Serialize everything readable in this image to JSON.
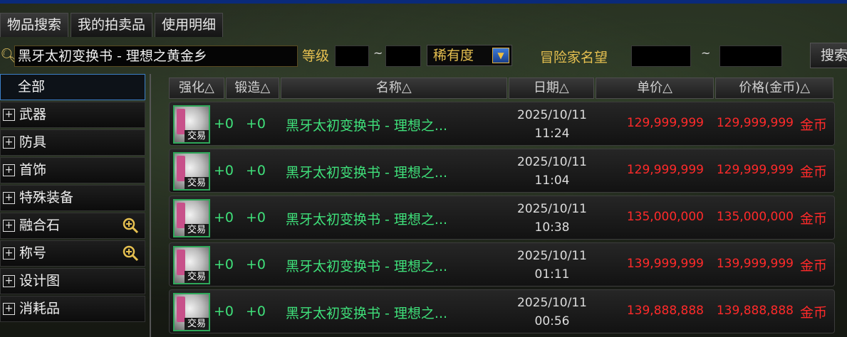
{
  "tabs": [
    "物品搜索",
    "我的拍卖品",
    "使用明细"
  ],
  "search": {
    "keyword": "黑牙太初变换书 - 理想之黄金乡",
    "level_label": "等级",
    "level_sep": "~",
    "rarity_label": "稀有度",
    "adventurer_label": "冒险家名望",
    "adventurer_sep": "~",
    "button_label": "搜索"
  },
  "sidebar": {
    "items": [
      {
        "label": "全部",
        "expandable": false,
        "zoom": false
      },
      {
        "label": "武器",
        "expandable": true,
        "zoom": false
      },
      {
        "label": "防具",
        "expandable": true,
        "zoom": false
      },
      {
        "label": "首饰",
        "expandable": true,
        "zoom": false
      },
      {
        "label": "特殊装备",
        "expandable": true,
        "zoom": false
      },
      {
        "label": "融合石",
        "expandable": true,
        "zoom": true
      },
      {
        "label": "称号",
        "expandable": true,
        "zoom": true
      },
      {
        "label": "设计图",
        "expandable": true,
        "zoom": false
      },
      {
        "label": "消耗品",
        "expandable": true,
        "zoom": false
      }
    ]
  },
  "table": {
    "headers": [
      "强化△",
      "锻造△",
      "名称△",
      "日期△",
      "单价△",
      "价格(金币)△"
    ],
    "rows": [
      {
        "icon_tag": "交易",
        "enhance": "+0",
        "forge": "+0",
        "name": "黑牙太初变换书 - 理想之...",
        "date": "2025/10/11",
        "time": "11:24",
        "unit_price": "129,999,999",
        "price": "129,999,999",
        "currency": "金币"
      },
      {
        "icon_tag": "交易",
        "enhance": "+0",
        "forge": "+0",
        "name": "黑牙太初变换书 - 理想之...",
        "date": "2025/10/11",
        "time": "11:04",
        "unit_price": "129,999,999",
        "price": "129,999,999",
        "currency": "金币"
      },
      {
        "icon_tag": "交易",
        "enhance": "+0",
        "forge": "+0",
        "name": "黑牙太初变换书 - 理想之...",
        "date": "2025/10/11",
        "time": "10:38",
        "unit_price": "135,000,000",
        "price": "135,000,000",
        "currency": "金币"
      },
      {
        "icon_tag": "交易",
        "enhance": "+0",
        "forge": "+0",
        "name": "黑牙太初变换书 - 理想之...",
        "date": "2025/10/11",
        "time": "01:11",
        "unit_price": "139,999,999",
        "price": "139,999,999",
        "currency": "金币"
      },
      {
        "icon_tag": "交易",
        "enhance": "+0",
        "forge": "+0",
        "name": "黑牙太初变换书 - 理想之...",
        "date": "2025/10/11",
        "time": "00:56",
        "unit_price": "139,888,888",
        "price": "139,888,888",
        "currency": "金币"
      }
    ]
  },
  "colors": {
    "price": "#ff2a2a",
    "name": "#3fe07a",
    "label_gold": "#e6c050",
    "accent_blue": "#3c7fc8"
  },
  "icons": [
    "search-icon",
    "dropdown-arrow-icon",
    "expand-plus-icon",
    "zoom-in-icon",
    "item-icon"
  ]
}
